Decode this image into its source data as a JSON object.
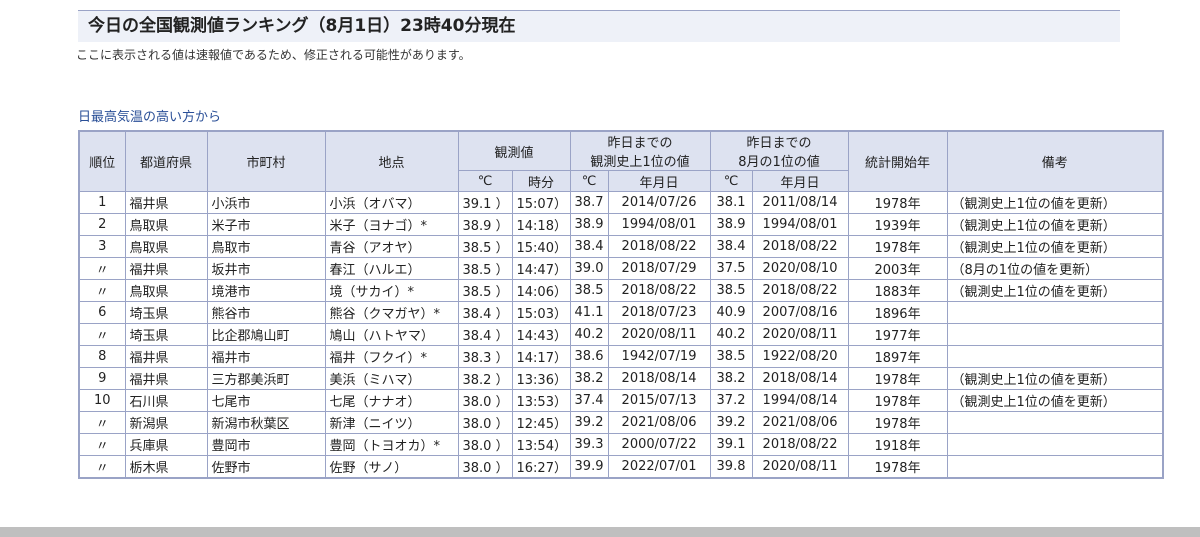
{
  "page_title": "今日の全国観測値ランキング（8月1日）23時40分現在",
  "note": "ここに表示される値は速報値であるため、修正される可能性があります。",
  "section_title": "日最高気温の高い方から",
  "table": {
    "headers": {
      "rank": "順位",
      "prefecture": "都道府県",
      "municipality": "市町村",
      "station": "地点",
      "observed": "観測値",
      "record_all_line1": "昨日までの",
      "record_all_line2": "観測史上1位の値",
      "record_aug_line1": "昨日までの",
      "record_aug_line2": "8月の1位の値",
      "start_year": "統計開始年",
      "remarks": "備考",
      "celsius": "℃",
      "time": "時分",
      "celsius2": "℃",
      "date": "年月日",
      "celsius3": "℃",
      "date2": "年月日"
    },
    "rows": [
      {
        "rank": "1",
        "pref": "福井県",
        "city": "小浜市",
        "station": "小浜（オバマ）",
        "temp": "39.1 ）",
        "time": "15:07）",
        "rec_temp": "38.7",
        "rec_date": "2014/07/26",
        "aug_temp": "38.1",
        "aug_date": "2011/08/14",
        "start": "1978年",
        "remark": "（観測史上1位の値を更新）"
      },
      {
        "rank": "2",
        "pref": "鳥取県",
        "city": "米子市",
        "station": "米子（ヨナゴ）*",
        "temp": "38.9 ）",
        "time": "14:18）",
        "rec_temp": "38.9",
        "rec_date": "1994/08/01",
        "aug_temp": "38.9",
        "aug_date": "1994/08/01",
        "start": "1939年",
        "remark": "（観測史上1位の値を更新）"
      },
      {
        "rank": "3",
        "pref": "鳥取県",
        "city": "鳥取市",
        "station": "青谷（アオヤ）",
        "temp": "38.5 ）",
        "time": "15:40）",
        "rec_temp": "38.4",
        "rec_date": "2018/08/22",
        "aug_temp": "38.4",
        "aug_date": "2018/08/22",
        "start": "1978年",
        "remark": "（観測史上1位の値を更新）"
      },
      {
        "rank": "〃",
        "pref": "福井県",
        "city": "坂井市",
        "station": "春江（ハルエ）",
        "temp": "38.5 ）",
        "time": "14:47）",
        "rec_temp": "39.0",
        "rec_date": "2018/07/29",
        "aug_temp": "37.5",
        "aug_date": "2020/08/10",
        "start": "2003年",
        "remark": "（8月の1位の値を更新）"
      },
      {
        "rank": "〃",
        "pref": "鳥取県",
        "city": "境港市",
        "station": "境（サカイ）*",
        "temp": "38.5 ）",
        "time": "14:06）",
        "rec_temp": "38.5",
        "rec_date": "2018/08/22",
        "aug_temp": "38.5",
        "aug_date": "2018/08/22",
        "start": "1883年",
        "remark": "（観測史上1位の値を更新）"
      },
      {
        "rank": "6",
        "pref": "埼玉県",
        "city": "熊谷市",
        "station": "熊谷（クマガヤ）*",
        "temp": "38.4 ）",
        "time": "15:03）",
        "rec_temp": "41.1",
        "rec_date": "2018/07/23",
        "aug_temp": "40.9",
        "aug_date": "2007/08/16",
        "start": "1896年",
        "remark": ""
      },
      {
        "rank": "〃",
        "pref": "埼玉県",
        "city": "比企郡鳩山町",
        "station": "鳩山（ハトヤマ）",
        "temp": "38.4 ）",
        "time": "14:43）",
        "rec_temp": "40.2",
        "rec_date": "2020/08/11",
        "aug_temp": "40.2",
        "aug_date": "2020/08/11",
        "start": "1977年",
        "remark": ""
      },
      {
        "rank": "8",
        "pref": "福井県",
        "city": "福井市",
        "station": "福井（フクイ）*",
        "temp": "38.3 ）",
        "time": "14:17）",
        "rec_temp": "38.6",
        "rec_date": "1942/07/19",
        "aug_temp": "38.5",
        "aug_date": "1922/08/20",
        "start": "1897年",
        "remark": ""
      },
      {
        "rank": "9",
        "pref": "福井県",
        "city": "三方郡美浜町",
        "station": "美浜（ミハマ）",
        "temp": "38.2 ）",
        "time": "13:36）",
        "rec_temp": "38.2",
        "rec_date": "2018/08/14",
        "aug_temp": "38.2",
        "aug_date": "2018/08/14",
        "start": "1978年",
        "remark": "（観測史上1位の値を更新）"
      },
      {
        "rank": "10",
        "pref": "石川県",
        "city": "七尾市",
        "station": "七尾（ナナオ）",
        "temp": "38.0 ）",
        "time": "13:53）",
        "rec_temp": "37.4",
        "rec_date": "2015/07/13",
        "aug_temp": "37.2",
        "aug_date": "1994/08/14",
        "start": "1978年",
        "remark": "（観測史上1位の値を更新）"
      },
      {
        "rank": "〃",
        "pref": "新潟県",
        "city": "新潟市秋葉区",
        "station": "新津（ニイツ）",
        "temp": "38.0 ）",
        "time": "12:45）",
        "rec_temp": "39.2",
        "rec_date": "2021/08/06",
        "aug_temp": "39.2",
        "aug_date": "2021/08/06",
        "start": "1978年",
        "remark": ""
      },
      {
        "rank": "〃",
        "pref": "兵庫県",
        "city": "豊岡市",
        "station": "豊岡（トヨオカ）*",
        "temp": "38.0 ）",
        "time": "13:54）",
        "rec_temp": "39.3",
        "rec_date": "2000/07/22",
        "aug_temp": "39.1",
        "aug_date": "2018/08/22",
        "start": "1918年",
        "remark": ""
      },
      {
        "rank": "〃",
        "pref": "栃木県",
        "city": "佐野市",
        "station": "佐野（サノ）",
        "temp": "38.0 ）",
        "time": "16:27）",
        "rec_temp": "39.9",
        "rec_date": "2022/07/01",
        "aug_temp": "39.8",
        "aug_date": "2020/08/11",
        "start": "1978年",
        "remark": ""
      }
    ]
  }
}
